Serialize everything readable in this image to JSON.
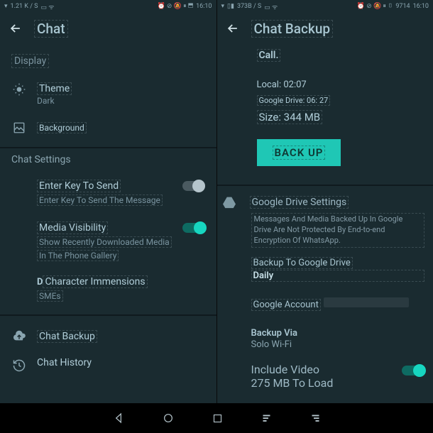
{
  "left": {
    "status": {
      "net": "1.21 K / S",
      "time": "16:10"
    },
    "title": "Chat",
    "display_label": "Display",
    "theme": {
      "title": "Theme",
      "value": "Dark"
    },
    "background": {
      "title": "Background"
    },
    "chat_settings_label": "Chat Settings",
    "enter_key": {
      "title": "Enter Key To Send",
      "sub": "Enter Key To Send The Message"
    },
    "media": {
      "title": "Media Visibility",
      "sub1": "Show Recently Downloaded Media",
      "sub2": "In The Phone Gallery"
    },
    "chardim": {
      "title": "Character Immensions",
      "sub": "SMEs"
    },
    "chat_backup": "Chat Backup",
    "chat_history": "Chat History"
  },
  "right": {
    "status": {
      "net": "373B / S",
      "battery": "9714",
      "time": "16:10"
    },
    "title": "Chat Backup",
    "call": "Call.",
    "local": "Local: 02:07",
    "gdrive_time": "Google Drive: 06: 27",
    "size": "Size: 344 MB",
    "backup_btn": "BACK UP",
    "gdrive": {
      "label": "Google Drive Settings",
      "desc": "Messages And Media Backed Up In Google Drive Are Not Protected By End-to-end Encryption Of WhatsApp.",
      "backup_to": {
        "title": "Backup To Google Drive",
        "value": "Daily"
      },
      "account": {
        "title": "Google Account"
      },
      "via": {
        "title": "Backup Via",
        "value": "Solo Wi-Fi"
      },
      "include": {
        "title": "Include Video",
        "sub": "275 MB To Load"
      }
    }
  }
}
